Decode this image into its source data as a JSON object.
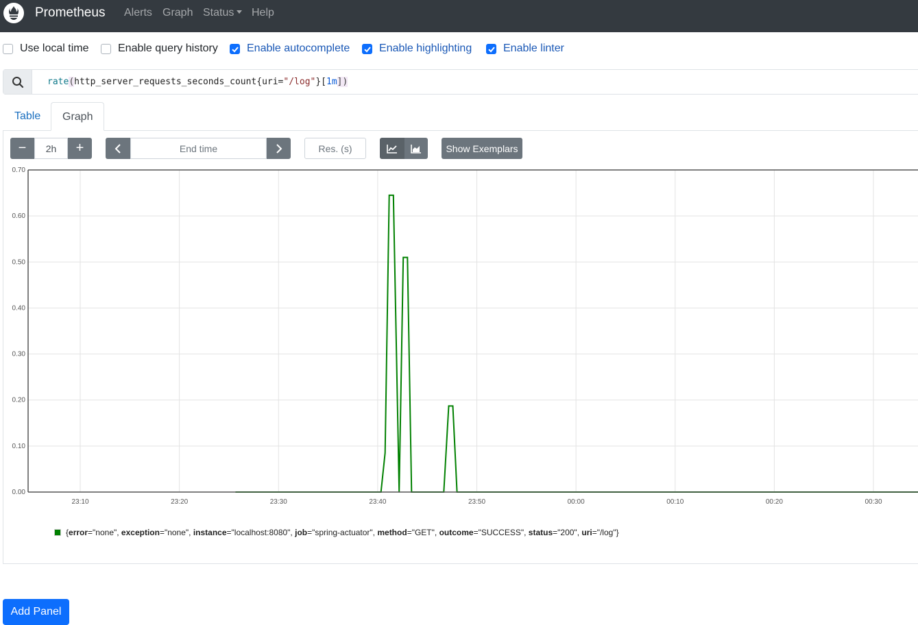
{
  "navbar": {
    "brand": "Prometheus",
    "links": [
      "Alerts",
      "Graph",
      "Status",
      "Help"
    ]
  },
  "options": [
    {
      "label": "Use local time",
      "checked": false
    },
    {
      "label": "Enable query history",
      "checked": false
    },
    {
      "label": "Enable autocomplete",
      "checked": true
    },
    {
      "label": "Enable highlighting",
      "checked": true
    },
    {
      "label": "Enable linter",
      "checked": true
    }
  ],
  "query": {
    "fn": "rate",
    "open": "(",
    "metric": "http_server_requests_seconds_count{uri=",
    "string": "\"/log\"",
    "close_brace": "}[",
    "duration": "1m",
    "end": "])"
  },
  "tabs": {
    "table": "Table",
    "graph": "Graph"
  },
  "toolbar": {
    "minus": "−",
    "range": "2h",
    "plus": "+",
    "end_time_placeholder": "End time",
    "resolution_placeholder": "Res. (s)",
    "exemplars": "Show Exemplars"
  },
  "chart_data": {
    "type": "line",
    "y_ticks": [
      "0.00",
      "0.10",
      "0.20",
      "0.30",
      "0.40",
      "0.50",
      "0.60",
      "0.70"
    ],
    "x_ticks": [
      "23:10",
      "23:20",
      "23:30",
      "23:40",
      "23:50",
      "00:00",
      "00:10",
      "00:20",
      "00:30"
    ],
    "ylim": [
      0,
      0.7
    ],
    "grid": true,
    "series": [
      {
        "color": "#008000",
        "points": [
          [
            "23:25:40",
            0
          ],
          [
            "23:40:20",
            0
          ],
          [
            "23:40:45",
            0.085
          ],
          [
            "23:41:10",
            0.645
          ],
          [
            "23:41:35",
            0.645
          ],
          [
            "23:42:10",
            0
          ],
          [
            "23:42:35",
            0.51
          ],
          [
            "23:43:00",
            0.51
          ],
          [
            "23:43:25",
            0
          ],
          [
            "23:46:40",
            0
          ],
          [
            "23:47:10",
            0.187
          ],
          [
            "23:47:35",
            0.187
          ],
          [
            "23:48:00",
            0
          ],
          [
            "00:35:00",
            0
          ]
        ]
      }
    ]
  },
  "legend": {
    "open": "{",
    "pairs": [
      {
        "k": "error",
        "v": "\"none\""
      },
      {
        "k": "exception",
        "v": "\"none\""
      },
      {
        "k": "instance",
        "v": "\"localhost:8080\""
      },
      {
        "k": "job",
        "v": "\"spring-actuator\""
      },
      {
        "k": "method",
        "v": "\"GET\""
      },
      {
        "k": "outcome",
        "v": "\"SUCCESS\""
      },
      {
        "k": "status",
        "v": "\"200\""
      },
      {
        "k": "uri",
        "v": "\"/log\""
      }
    ],
    "close": "}"
  },
  "add_panel": "Add Panel"
}
